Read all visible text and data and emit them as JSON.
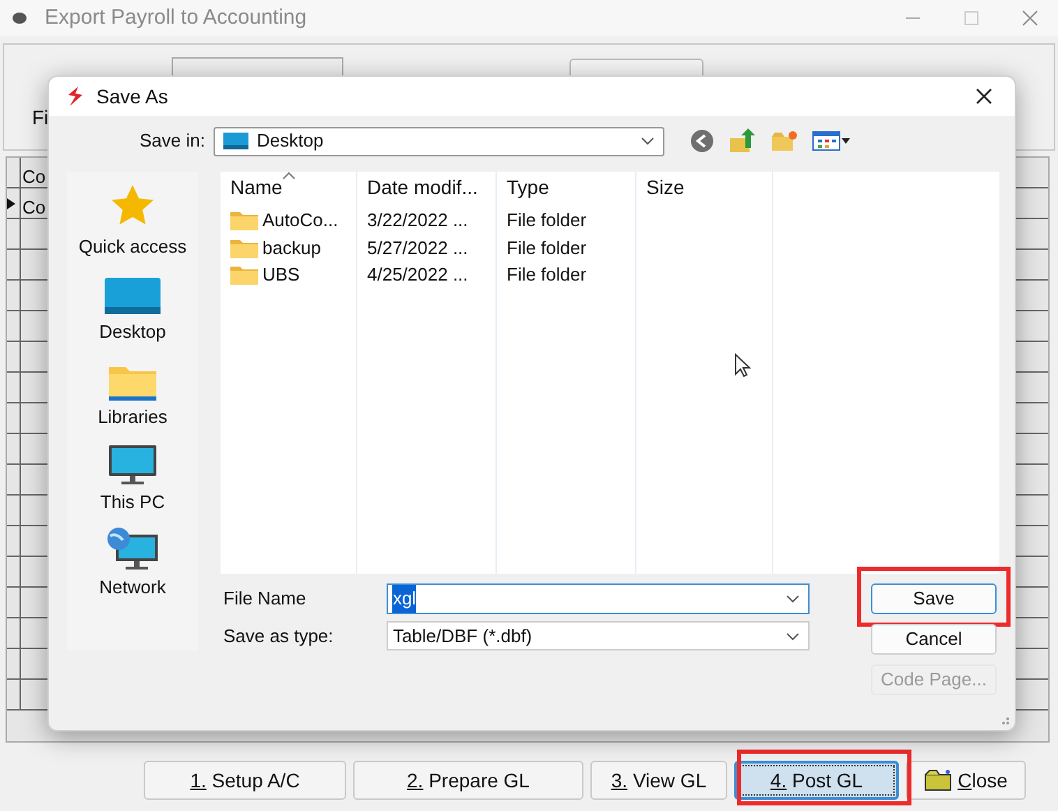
{
  "window": {
    "title": "Export Payroll to Accounting"
  },
  "background_form": {
    "field_2_label": "Fi",
    "grid_header": "Co",
    "grid_row": "Co"
  },
  "dialog": {
    "title": "Save As",
    "save_in_label": "Save in:",
    "save_in_value": "Desktop",
    "places": [
      {
        "label": "Quick access",
        "kind": "star"
      },
      {
        "label": "Desktop",
        "kind": "desktop"
      },
      {
        "label": "Libraries",
        "kind": "folder"
      },
      {
        "label": "This PC",
        "kind": "monitor"
      },
      {
        "label": "Network",
        "kind": "network"
      }
    ],
    "columns": [
      "Name",
      "Date modif...",
      "Type",
      "Size"
    ],
    "files": [
      {
        "name": "AutoCo...",
        "date": "3/22/2022 ...",
        "type": "File folder"
      },
      {
        "name": "backup",
        "date": "5/27/2022 ...",
        "type": "File folder"
      },
      {
        "name": "UBS",
        "date": "4/25/2022 ...",
        "type": "File folder"
      }
    ],
    "file_name_label": "File Name",
    "file_name_value": "xgl",
    "save_type_label": "Save as type:",
    "save_type_value": "Table/DBF (*.dbf)",
    "buttons": [
      {
        "label": "Save",
        "highlighted": true,
        "disabled": false
      },
      {
        "label": "Cancel",
        "highlighted": false,
        "disabled": false
      },
      {
        "label": "Code Page...",
        "highlighted": false,
        "disabled": true
      }
    ]
  },
  "bottom_buttons": [
    {
      "label": "1. Setup A/C",
      "highlighted": false,
      "icon": false
    },
    {
      "label": "2. Prepare GL",
      "highlighted": false,
      "icon": false
    },
    {
      "label": "3. View GL",
      "highlighted": false,
      "icon": false
    },
    {
      "label": "4. Post GL",
      "highlighted": true,
      "icon": false
    },
    {
      "label": "Close",
      "highlighted": false,
      "icon": true
    }
  ]
}
